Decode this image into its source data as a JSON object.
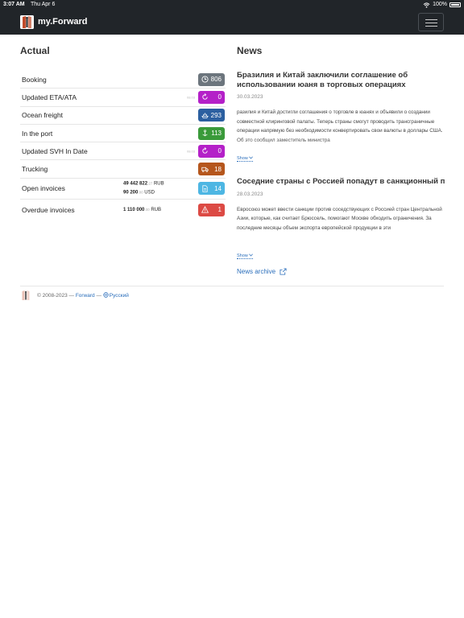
{
  "status_bar": {
    "time": "3:07 AM",
    "date": "Thu Apr 6",
    "battery": "100%"
  },
  "navbar": {
    "brand": "my.Forward"
  },
  "actual": {
    "title": "Actual",
    "rows": [
      {
        "label": "Booking",
        "count": "806",
        "color": "#6c757d",
        "icon": "clock-icon",
        "note": ""
      },
      {
        "label": "Updated ETA/ATA",
        "count": "0",
        "color": "#b420c8",
        "icon": "refresh-icon",
        "note": "08.03"
      },
      {
        "label": "Ocean freight",
        "count": "293",
        "color": "#2b5fa0",
        "icon": "ship-icon",
        "note": ""
      },
      {
        "label": "In the port",
        "count": "113",
        "color": "#3a9a3a",
        "icon": "anchor-icon",
        "note": ""
      },
      {
        "label": "Updated SVH In Date",
        "count": "0",
        "color": "#b420c8",
        "icon": "refresh-icon",
        "note": "08.03"
      },
      {
        "label": "Trucking",
        "count": "18",
        "color": "#b5561c",
        "icon": "truck-icon",
        "note": ""
      },
      {
        "label": "Open invoices",
        "count": "14",
        "color": "#4db6e3",
        "icon": "document-icon",
        "amount1_int": "49 442 822",
        "amount1_frac": ".27",
        "amount1_cur": "RUB",
        "amount2_int": "90 200",
        "amount2_frac": ".00",
        "amount2_cur": "USD"
      },
      {
        "label": "Overdue invoices",
        "count": "1",
        "color": "#dc4a44",
        "icon": "warning-icon",
        "amount1_int": "1 110 000",
        "amount1_frac": ".00",
        "amount1_cur": "RUB"
      }
    ]
  },
  "news": {
    "title": "News",
    "items": [
      {
        "title": "Бразилия и Китай заключили соглашение об использовании юаня в торговых операциях",
        "date": "30.03.2023",
        "body": "разилия и Китай достигли соглашения о торговле в юанях и объявили о создании совместной клиринговой палаты. Теперь страны смогут проводить трансграничные операции напрямую без необходимости конвертировать свои валюты в доллары США. Об это сообщил заместитель министра",
        "show": "Show"
      },
      {
        "title": "Соседние страны с Россией попадут в санкционный прицел",
        "date": "28.03.2023",
        "body": "Евросоюз может ввести санкции против соседствующих с Россией стран Центральной Азии, которые, как считает Брюссель, помогают Москве обходить ограничения. За последние месяцы объем экспорта европейской продукции в эти",
        "show": "Show"
      }
    ],
    "archive": "News archive"
  },
  "footer": {
    "copyright": "© 2008-2023 —",
    "company": "Forward",
    "dash": "—",
    "language": "Русский"
  }
}
